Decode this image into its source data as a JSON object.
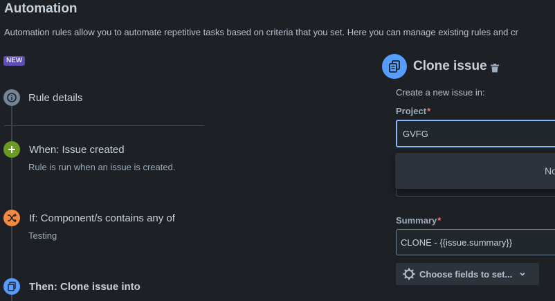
{
  "header": {
    "title": "Automation",
    "description": "Automation rules allow you to automate repetitive tasks based on criteria that you set. Here you can manage existing rules and cr"
  },
  "badge": "NEW",
  "steps": [
    {
      "title": "Rule details",
      "subtitle": "",
      "icon": "info-icon",
      "color": "#738496"
    },
    {
      "title": "When: Issue created",
      "subtitle": "Rule is run when an issue is created.",
      "icon": "plus-icon",
      "color": "#6a9a23"
    },
    {
      "title": "If: Component/s contains any of",
      "subtitle": "Testing",
      "icon": "shuffle-icon",
      "color": "#f38a3f"
    },
    {
      "title": "Then: Clone issue into",
      "subtitle": "",
      "icon": "clone-icon",
      "color": "#579dff"
    }
  ],
  "panel": {
    "title": "Clone issue",
    "create_label": "Create a new issue in:",
    "project_label": "Project",
    "project_value": "GVFG",
    "dropdown_text": "No",
    "summary_label": "Summary",
    "summary_value": "CLONE - {{issue.summary}}",
    "choose_fields_label": "Choose fields to set..."
  },
  "colors": {
    "background": "#1d2125",
    "accent": "#579dff",
    "required": "#f87168"
  }
}
